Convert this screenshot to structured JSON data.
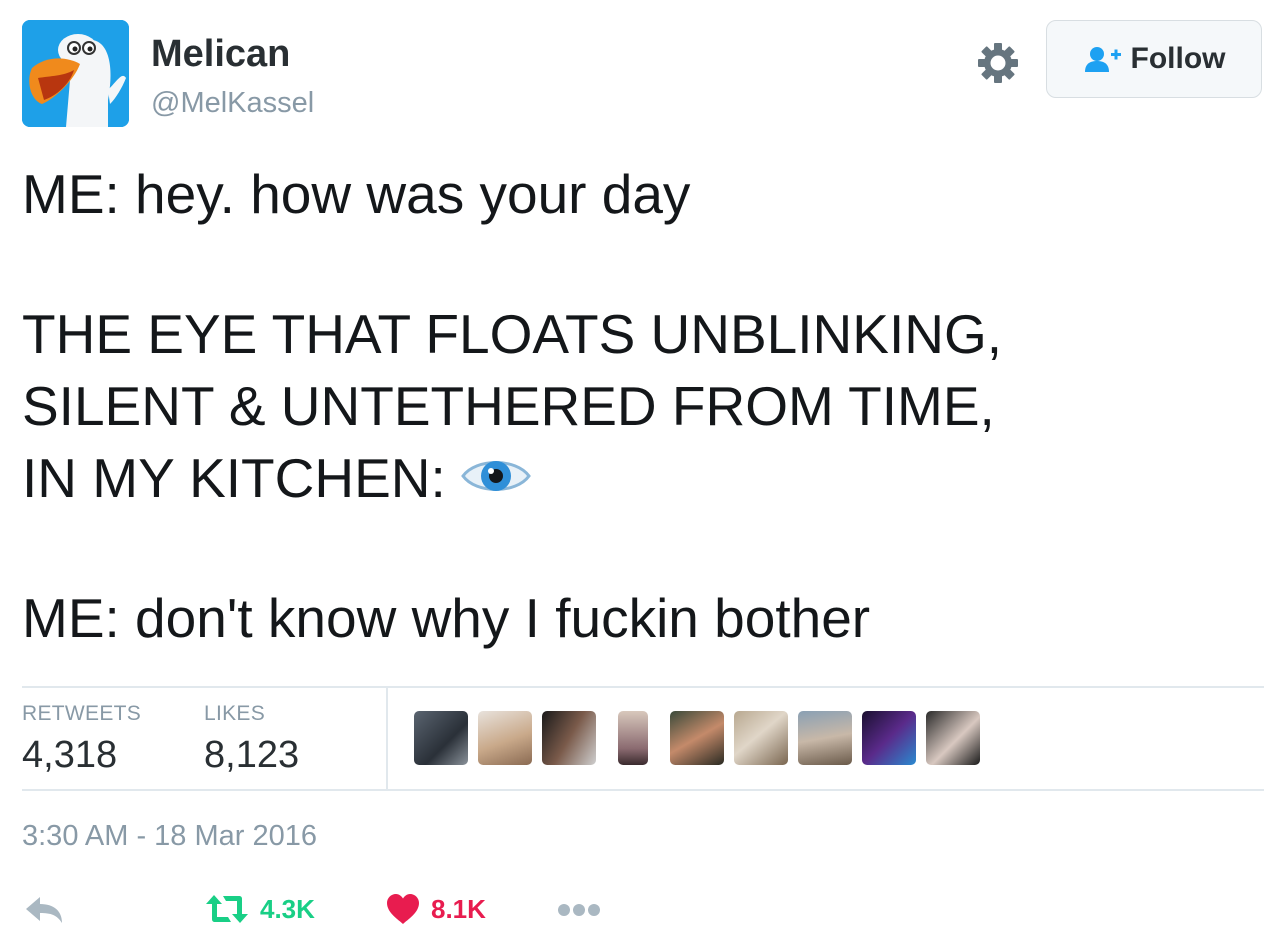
{
  "user": {
    "display_name": "Melican",
    "handle": "@MelKassel"
  },
  "header": {
    "follow_label": "Follow"
  },
  "tweet": {
    "lines": [
      "ME: hey. how was your day",
      "THE EYE THAT FLOATS UNBLINKING,",
      "SILENT & UNTETHERED FROM TIME,",
      "IN MY KITCHEN:",
      "ME: don't know why I fuckin bother"
    ]
  },
  "stats": {
    "retweets_label": "RETWEETS",
    "retweets_value": "4,318",
    "likes_label": "LIKES",
    "likes_value": "8,123"
  },
  "likers_count": 9,
  "timestamp": "3:30 AM - 18 Mar 2016",
  "actions": {
    "retweet_count": "4.3K",
    "like_count": "8.1K"
  },
  "colors": {
    "retweet_green": "#19cf86",
    "like_red": "#e81c4f",
    "muted": "#8899a6",
    "brand_blue": "#1da1f2"
  }
}
